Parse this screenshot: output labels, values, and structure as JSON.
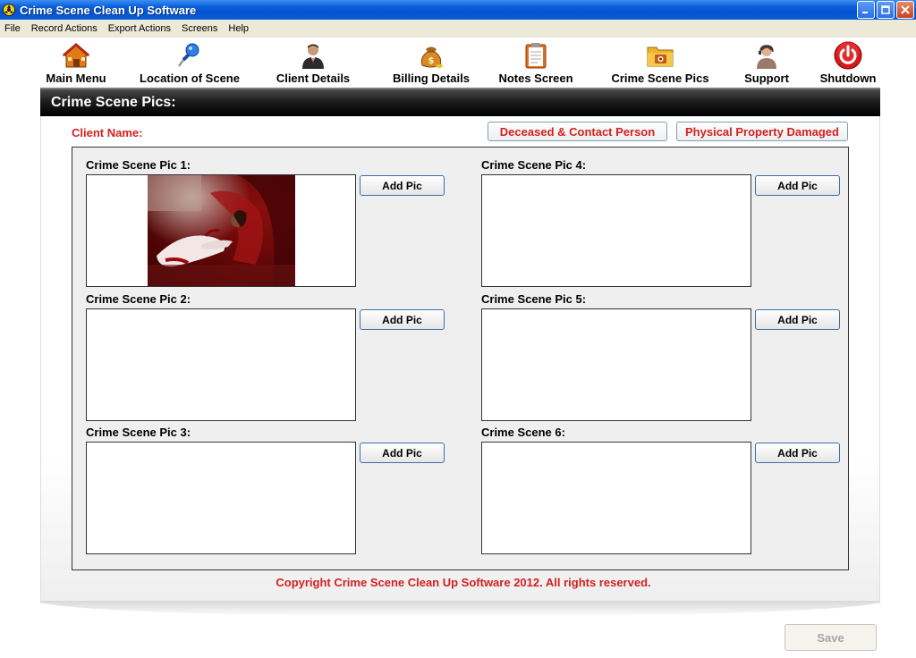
{
  "window": {
    "title": "Crime Scene Clean Up Software"
  },
  "menu": [
    "File",
    "Record Actions",
    "Export Actions",
    "Screens",
    "Help"
  ],
  "toolbar": [
    {
      "label": "Main Menu",
      "icon": "house-icon"
    },
    {
      "label": "Location of Scene",
      "icon": "pushpin-icon"
    },
    {
      "label": "Client Details",
      "icon": "person-icon"
    },
    {
      "label": "Billing Details",
      "icon": "money-bag-icon"
    },
    {
      "label": "Notes Screen",
      "icon": "clipboard-icon"
    },
    {
      "label": "Crime Scene Pics",
      "icon": "photo-folder-icon"
    },
    {
      "label": "Support",
      "icon": "support-agent-icon"
    },
    {
      "label": "Shutdown",
      "icon": "power-icon"
    }
  ],
  "section": {
    "title": "Crime Scene Pics:"
  },
  "client": {
    "label": "Client Name:"
  },
  "actions": {
    "deceased": "Deceased & Contact Person",
    "property": "Physical Property Damaged"
  },
  "pics": [
    {
      "label": "Crime Scene Pic 1:",
      "button": "Add Pic"
    },
    {
      "label": "Crime Scene Pic 2:",
      "button": "Add Pic"
    },
    {
      "label": "Crime Scene Pic 3:",
      "button": "Add Pic"
    },
    {
      "label": "Crime Scene Pic 4:",
      "button": "Add Pic"
    },
    {
      "label": "Crime Scene Pic 5:",
      "button": "Add Pic"
    },
    {
      "label": "Crime Scene 6:",
      "button": "Add Pic"
    }
  ],
  "footer": {
    "copyright": "Copyright Crime Scene Clean Up Software 2012. All rights reserved.",
    "save": "Save"
  },
  "colors": {
    "accent_red": "#d42020",
    "titlebar_blue": "#0353cf"
  }
}
